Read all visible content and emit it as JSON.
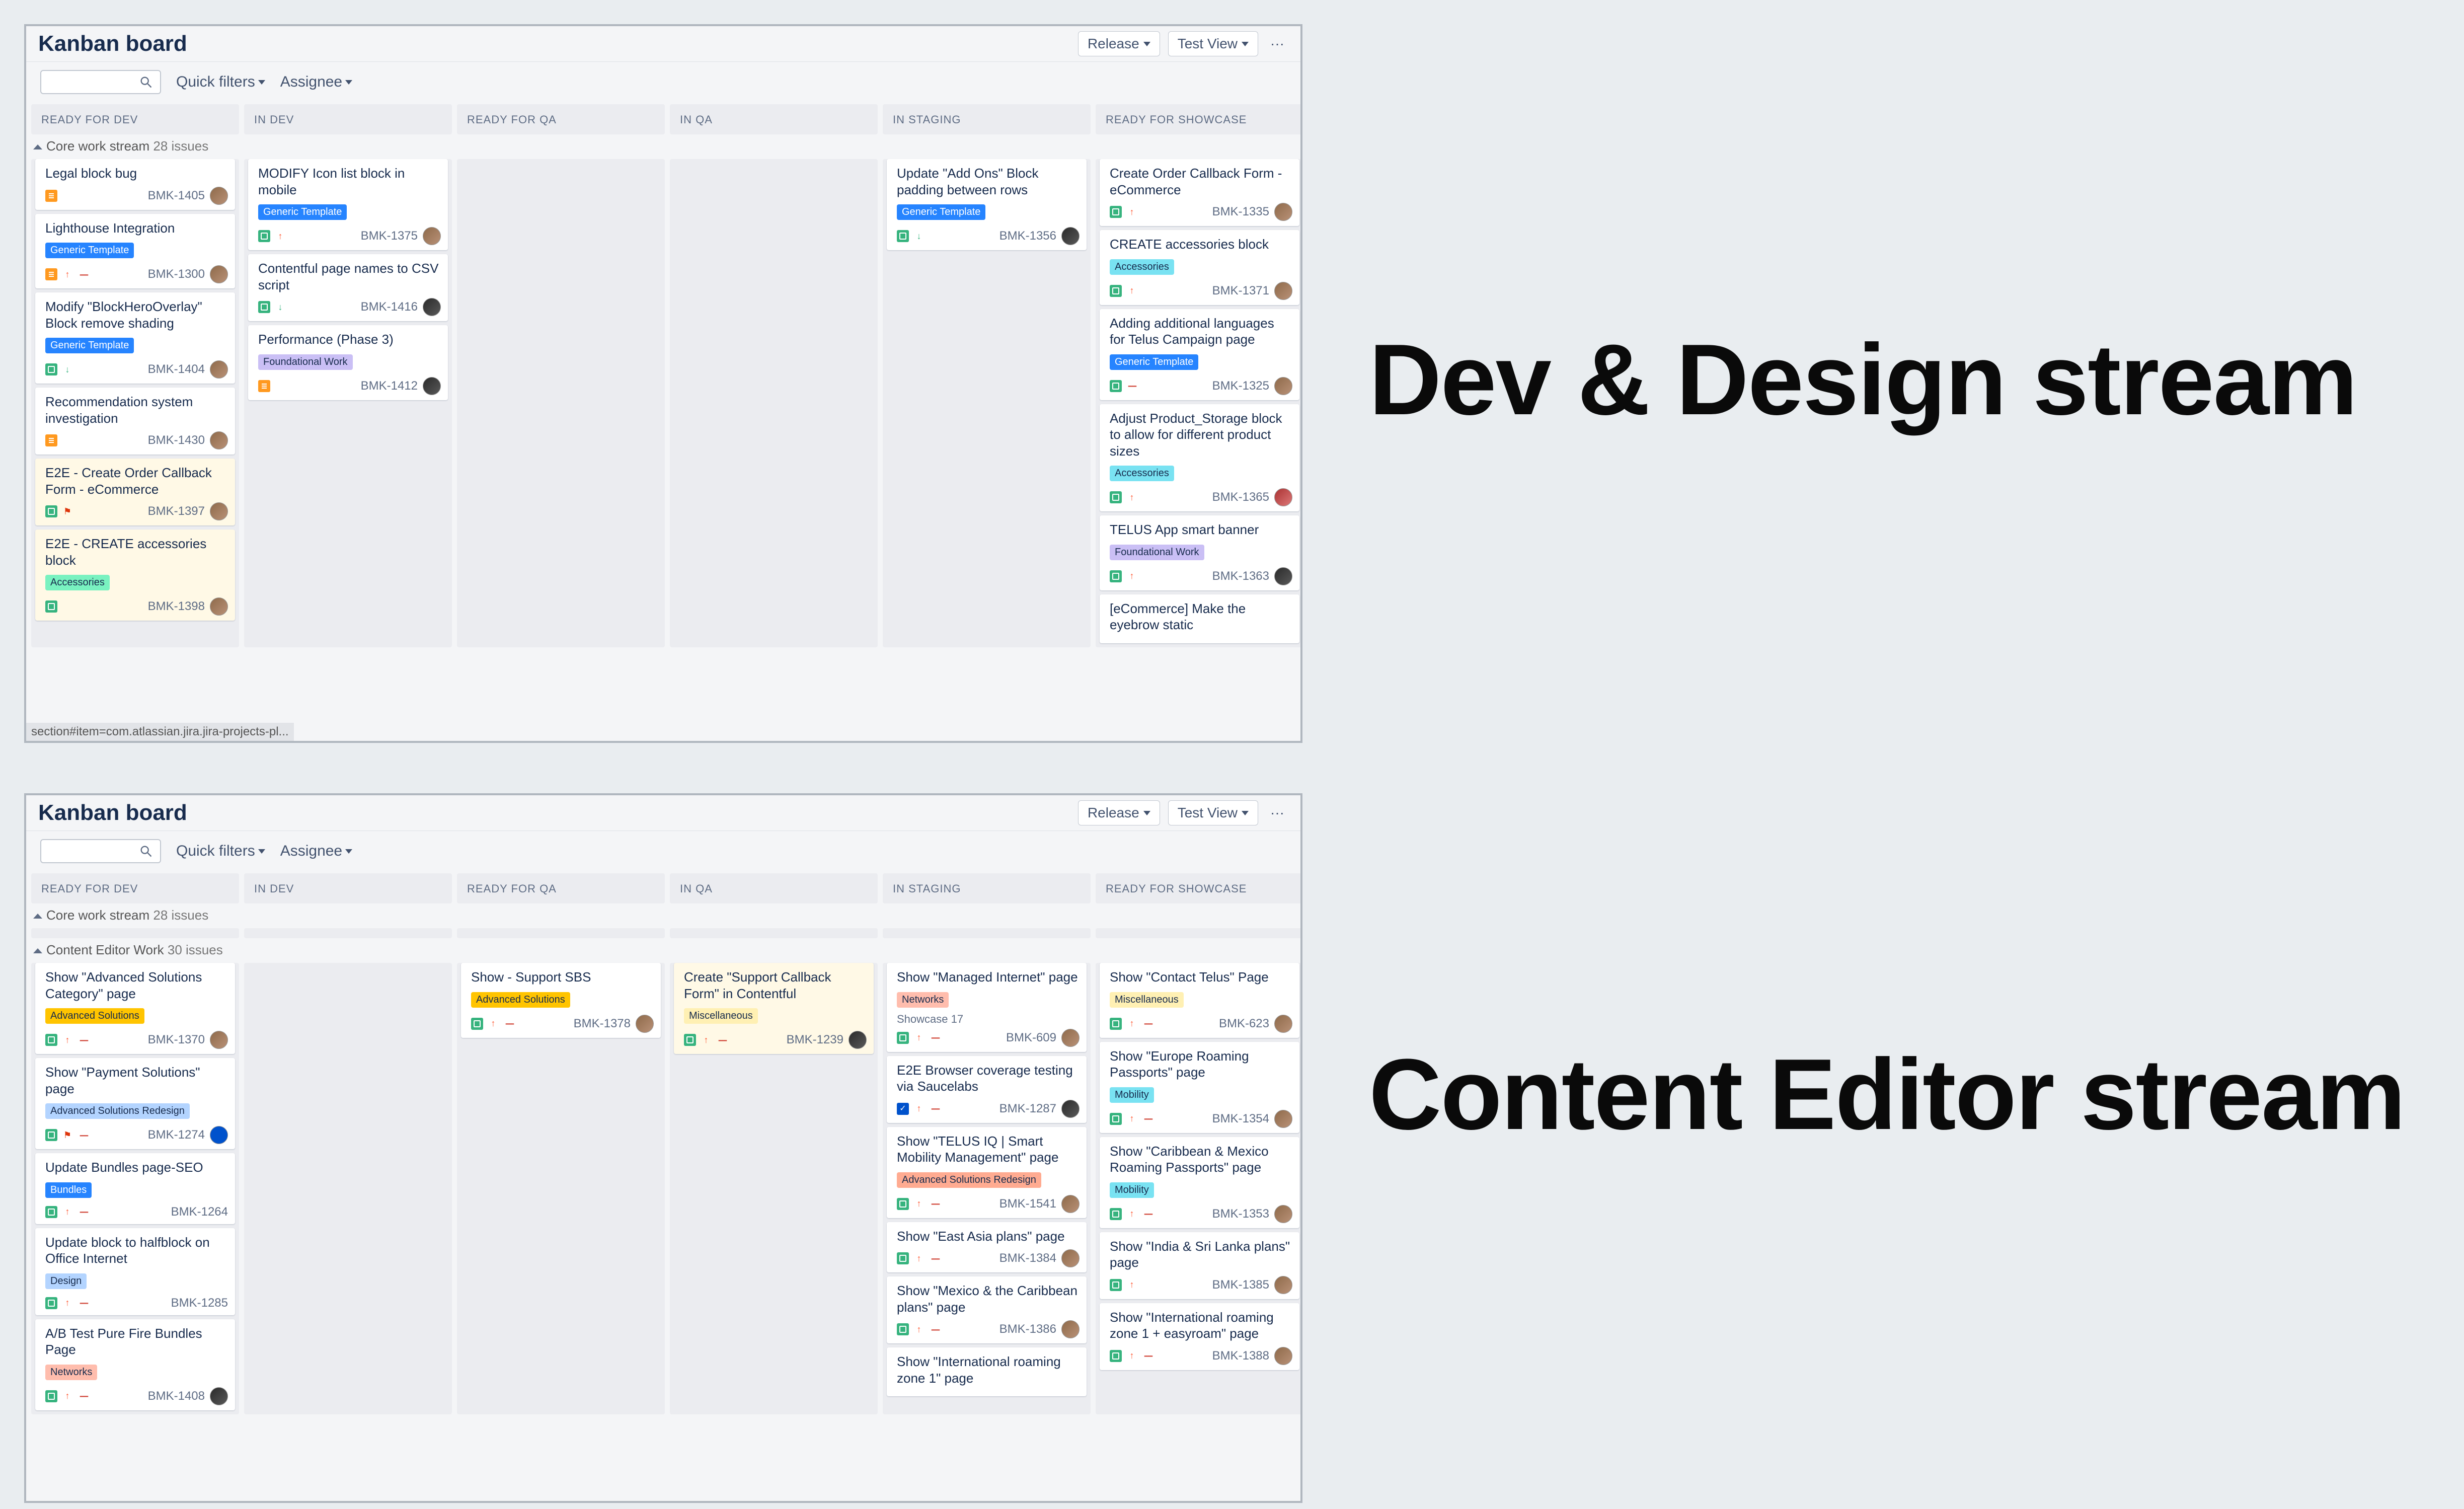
{
  "labels": {
    "dev": "Dev & Design stream",
    "content": "Content Editor stream"
  },
  "board_common": {
    "title": "Kanban board",
    "release_btn": "Release",
    "testview_btn": "Test View",
    "more": "···",
    "quick_filters": "Quick filters",
    "assignee": "Assignee"
  },
  "columns": [
    "READY FOR DEV",
    "IN DEV",
    "READY FOR QA",
    "IN QA",
    "IN STAGING",
    "READY FOR SHOWCASE"
  ],
  "board1": {
    "swimlanes": [
      {
        "name": "Core work stream",
        "count": "28 issues"
      }
    ],
    "tooltip": "section#item=com.atlassian.jira.jira-projects-pl...",
    "cards": {
      "ready_for_dev": [
        {
          "title": "Legal block bug",
          "tag": null,
          "key": "BMK-1405",
          "type": "task",
          "pri": "",
          "dash": false,
          "avatar": "brown"
        },
        {
          "title": "Lighthouse Integration",
          "tag": {
            "t": "Generic Template",
            "c": "tag-darkblue"
          },
          "key": "BMK-1300",
          "type": "task",
          "pri": "up",
          "dash": true,
          "avatar": "brown"
        },
        {
          "title": "Modify \"BlockHeroOverlay\" Block remove shading",
          "tag": {
            "t": "Generic Template",
            "c": "tag-darkblue"
          },
          "key": "BMK-1404",
          "type": "story",
          "pri": "down",
          "dash": false,
          "avatar": "brown"
        },
        {
          "title": "Recommendation system investigation",
          "tag": null,
          "key": "BMK-1430",
          "type": "task",
          "pri": "",
          "dash": false,
          "avatar": "brown"
        },
        {
          "title": "E2E - Create Order Callback Form - eCommerce",
          "tag": null,
          "key": "BMK-1397",
          "type": "story",
          "pri": "",
          "flag": true,
          "dash": false,
          "avatar": "brown",
          "hl": true
        },
        {
          "title": "E2E - CREATE accessories block",
          "tag": {
            "t": "Accessories",
            "c": "tag-mint"
          },
          "key": "BMK-1398",
          "type": "story",
          "pri": "",
          "dash": false,
          "avatar": "brown",
          "hl": true
        }
      ],
      "in_dev": [
        {
          "title": "MODIFY Icon list block in mobile",
          "tag": {
            "t": "Generic Template",
            "c": "tag-darkblue"
          },
          "key": "BMK-1375",
          "type": "story",
          "pri": "up",
          "dash": false,
          "avatar": "brown"
        },
        {
          "title": "Contentful page names to CSV script",
          "tag": null,
          "key": "BMK-1416",
          "type": "story",
          "pri": "down",
          "dash": false,
          "avatar": "dark"
        },
        {
          "title": "Performance (Phase 3)",
          "tag": {
            "t": "Foundational Work",
            "c": "tag-purple"
          },
          "key": "BMK-1412",
          "type": "task",
          "pri": "",
          "dash": false,
          "avatar": "dark"
        }
      ],
      "ready_for_qa": [],
      "in_qa": [],
      "in_staging": [
        {
          "title": "Update \"Add Ons\" Block padding between rows",
          "tag": {
            "t": "Generic Template",
            "c": "tag-darkblue"
          },
          "key": "BMK-1356",
          "type": "story",
          "pri": "down",
          "dash": false,
          "avatar": "dark"
        }
      ],
      "ready_for_showcase": [
        {
          "title": "Create Order Callback Form - eCommerce",
          "tag": null,
          "key": "BMK-1335",
          "type": "story",
          "pri": "up",
          "dash": false,
          "avatar": "brown"
        },
        {
          "title": "CREATE accessories block",
          "tag": {
            "t": "Accessories",
            "c": "tag-teal"
          },
          "key": "BMK-1371",
          "type": "story",
          "pri": "up",
          "dash": false,
          "avatar": "brown"
        },
        {
          "title": "Adding additional languages for Telus Campaign page",
          "tag": {
            "t": "Generic Template",
            "c": "tag-darkblue"
          },
          "key": "BMK-1325",
          "type": "story",
          "pri": "",
          "dash": true,
          "avatar": "brown"
        },
        {
          "title": "Adjust Product_Storage block to allow for different product sizes",
          "tag": {
            "t": "Accessories",
            "c": "tag-teal"
          },
          "key": "BMK-1365",
          "type": "story",
          "pri": "up",
          "dash": false,
          "avatar": "red"
        },
        {
          "title": "TELUS App smart banner",
          "tag": {
            "t": "Foundational Work",
            "c": "tag-purple"
          },
          "key": "BMK-1363",
          "type": "story",
          "pri": "up",
          "dash": false,
          "avatar": "dark"
        },
        {
          "title": "[eCommerce] Make the eyebrow static",
          "tag": null,
          "key": "",
          "type": "",
          "pri": "",
          "dash": false,
          "avatar": ""
        }
      ]
    }
  },
  "board2": {
    "swimlanes": [
      {
        "name": "Core work stream",
        "count": "28 issues"
      },
      {
        "name": "Content Editor Work",
        "count": "30 issues"
      }
    ],
    "cards": {
      "ready_for_dev": [
        {
          "title": "Show \"Advanced Solutions Category\" page",
          "tag": {
            "t": "Advanced Solutions",
            "c": "tag-orange"
          },
          "key": "BMK-1370",
          "type": "story",
          "pri": "up",
          "dash": true,
          "avatar": "brown"
        },
        {
          "title": "Show \"Payment Solutions\" page",
          "tag": {
            "t": "Advanced Solutions Redesign",
            "c": "tag-lightblue"
          },
          "key": "BMK-1274",
          "type": "story",
          "pri": "",
          "flag": true,
          "dash": true,
          "avatar": "blue"
        },
        {
          "title": "Update Bundles page-SEO",
          "tag": {
            "t": "Bundles",
            "c": "tag-darkblue"
          },
          "key": "BMK-1264",
          "type": "story",
          "pri": "up",
          "dash": true,
          "avatar": ""
        },
        {
          "title": "Update block to halfblock on Office Internet",
          "tag": {
            "t": "Design",
            "c": "tag-lightblue"
          },
          "key": "BMK-1285",
          "type": "story",
          "pri": "up",
          "dash": true,
          "avatar": ""
        },
        {
          "title": "A/B Test Pure Fire Bundles Page",
          "tag": {
            "t": "Networks",
            "c": "tag-salmon"
          },
          "key": "BMK-1408",
          "type": "story",
          "pri": "up",
          "dash": true,
          "avatar": "dark"
        }
      ],
      "in_dev": [],
      "ready_for_qa": [
        {
          "title": "Show - Support SBS",
          "tag": {
            "t": "Advanced Solutions",
            "c": "tag-orange"
          },
          "key": "BMK-1378",
          "type": "story",
          "pri": "up",
          "dash": true,
          "avatar": "brown"
        }
      ],
      "in_qa": [
        {
          "title": "Create \"Support Callback Form\" in Contentful",
          "tag": {
            "t": "Miscellaneous",
            "c": "tag-yellow"
          },
          "key": "BMK-1239",
          "type": "story",
          "pri": "up",
          "dash": true,
          "avatar": "dark",
          "hl": true
        }
      ],
      "in_staging": [
        {
          "title": "Show \"Managed Internet\" page",
          "tag": {
            "t": "Networks",
            "c": "tag-salmon"
          },
          "subtitle": "Showcase 17",
          "key": "BMK-609",
          "type": "story",
          "pri": "up",
          "dash": true,
          "avatar": "brown"
        },
        {
          "title": "E2E Browser coverage testing via Saucelabs",
          "tag": null,
          "key": "BMK-1287",
          "type": "check",
          "pri": "up",
          "dash": true,
          "avatar": "dark"
        },
        {
          "title": "Show \"TELUS IQ | Smart Mobility Management\" page",
          "tag": {
            "t": "Advanced Solutions Redesign",
            "c": "tag-orangeRed"
          },
          "key": "BMK-1541",
          "type": "story",
          "pri": "up",
          "dash": true,
          "avatar": "brown"
        },
        {
          "title": "Show \"East Asia plans\" page",
          "tag": null,
          "key": "BMK-1384",
          "type": "story",
          "pri": "up",
          "dash": true,
          "avatar": "brown"
        },
        {
          "title": "Show \"Mexico & the Caribbean plans\" page",
          "tag": null,
          "key": "BMK-1386",
          "type": "story",
          "pri": "up",
          "dash": true,
          "avatar": "brown"
        },
        {
          "title": "Show \"International roaming zone 1\" page",
          "tag": null,
          "key": "",
          "type": "",
          "pri": "",
          "dash": false,
          "avatar": ""
        }
      ],
      "ready_for_showcase": [
        {
          "title": "Show \"Contact Telus\" Page",
          "tag": {
            "t": "Miscellaneous",
            "c": "tag-yellow"
          },
          "key": "BMK-623",
          "type": "story",
          "pri": "up",
          "dash": true,
          "avatar": "brown"
        },
        {
          "title": "Show \"Europe Roaming Passports\" page",
          "tag": {
            "t": "Mobility",
            "c": "tag-teal"
          },
          "key": "BMK-1354",
          "type": "story",
          "pri": "up",
          "dash": true,
          "avatar": "brown"
        },
        {
          "title": "Show \"Caribbean & Mexico Roaming Passports\" page",
          "tag": {
            "t": "Mobility",
            "c": "tag-teal"
          },
          "key": "BMK-1353",
          "type": "story",
          "pri": "up",
          "dash": true,
          "avatar": "brown"
        },
        {
          "title": "Show \"India & Sri Lanka plans\" page",
          "tag": null,
          "key": "BMK-1385",
          "type": "story",
          "pri": "up",
          "dash": false,
          "avatar": "brown"
        },
        {
          "title": "Show \"International roaming zone 1 + easyroam\" page",
          "tag": null,
          "key": "BMK-1388",
          "type": "story",
          "pri": "up",
          "dash": true,
          "avatar": "brown"
        }
      ]
    }
  }
}
